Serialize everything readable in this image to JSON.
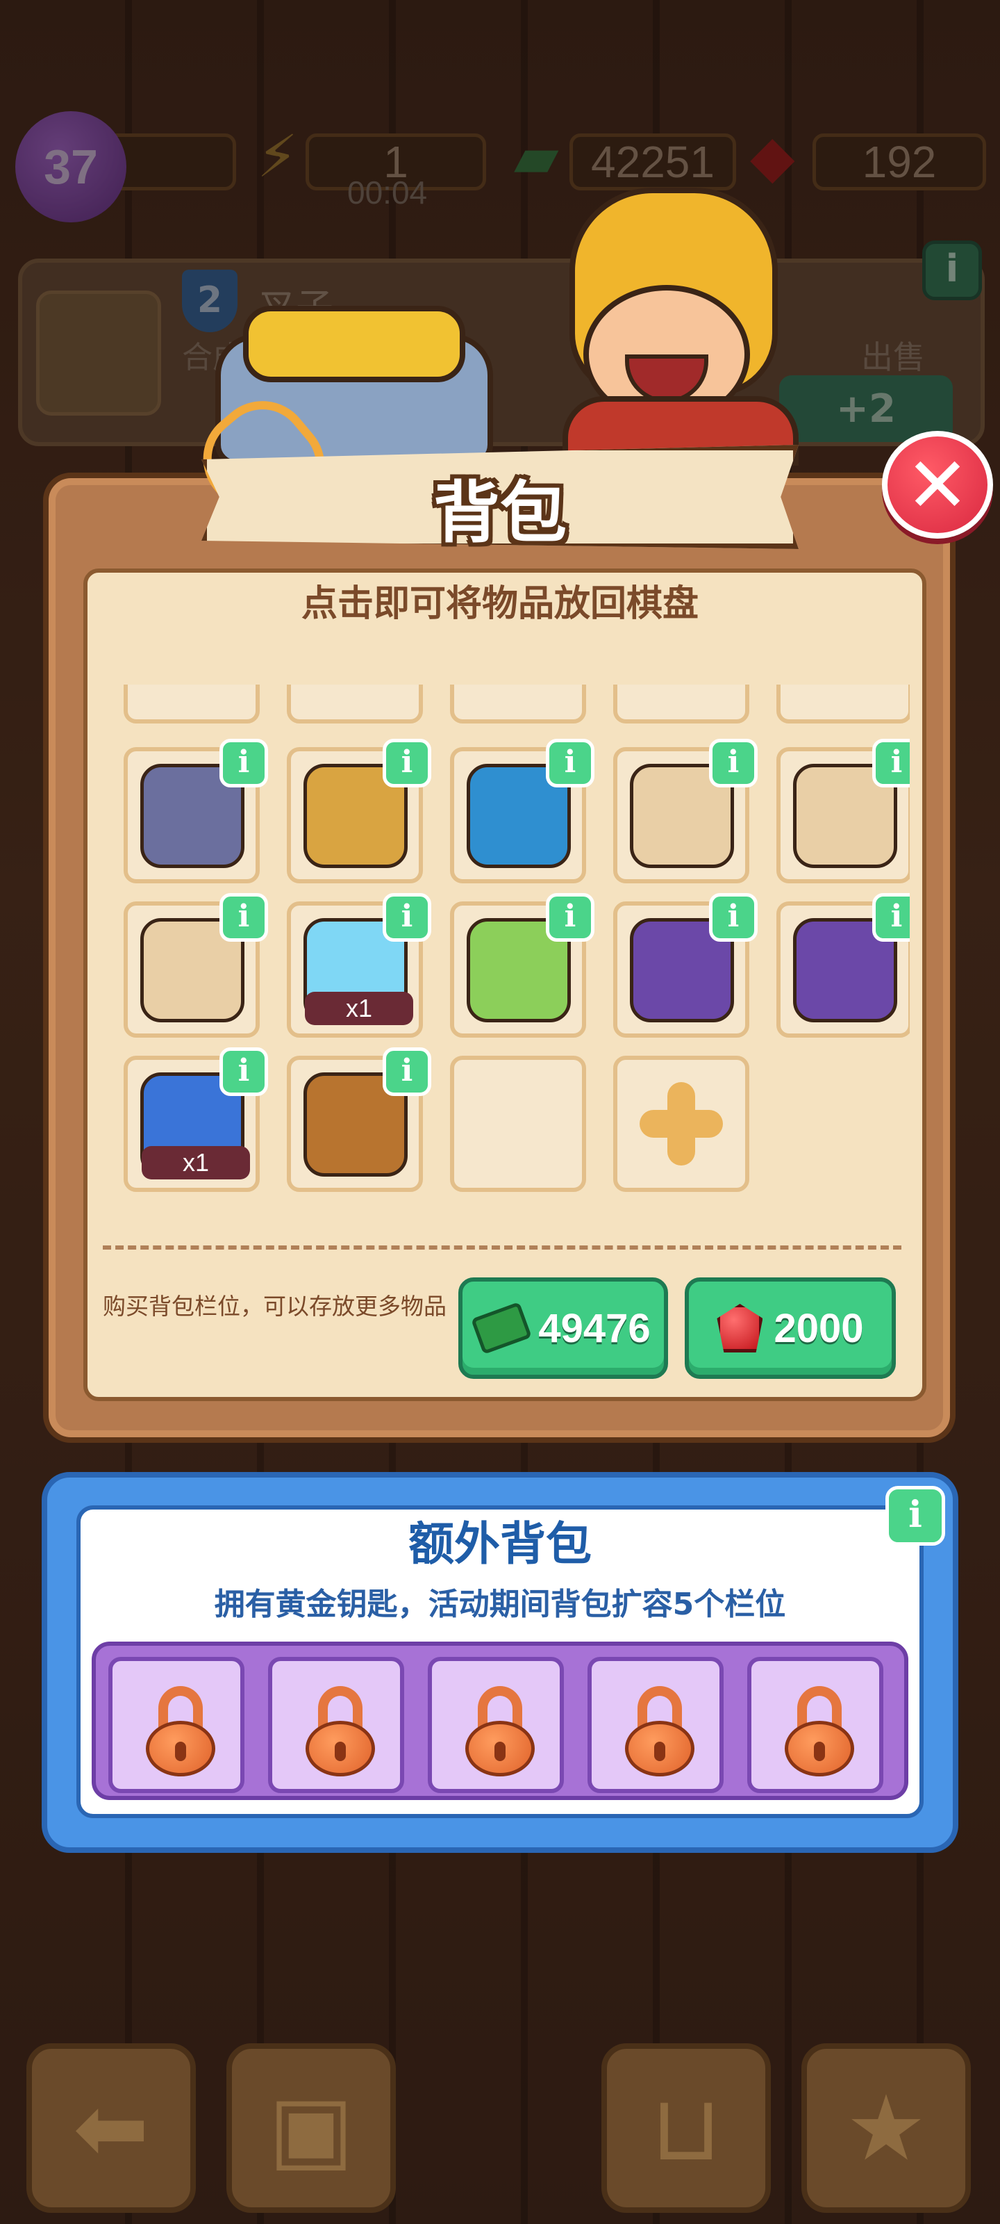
{
  "hud": {
    "level": "37",
    "energy": "1",
    "energy_timer": "00:04",
    "cash": "42251",
    "gems": "192"
  },
  "tool_card": {
    "tool_level": "2",
    "tool_name": "叉子",
    "tool_desc": "合成",
    "sell_label": "出售",
    "sell_value": "+2"
  },
  "backpack": {
    "title": "背包",
    "hint": "点击即可将物品放回棋盘",
    "info_glyph": "i",
    "close_glyph": "✕",
    "items": [
      {
        "name": "wheels-item",
        "qty": ""
      },
      {
        "name": "treasure-chest-item",
        "qty": ""
      },
      {
        "name": "jewel-chest-item",
        "qty": ""
      },
      {
        "name": "construction-box-item",
        "qty": ""
      },
      {
        "name": "construction-box-item",
        "qty": ""
      },
      {
        "name": "lightbulb-box-item",
        "qty": ""
      },
      {
        "name": "scissors-bubble-item",
        "qty": "x1"
      },
      {
        "name": "frog-slippers-item",
        "qty": ""
      },
      {
        "name": "purple-tent-item",
        "qty": ""
      },
      {
        "name": "purple-tent-item",
        "qty": ""
      },
      {
        "name": "upgrade-card-item",
        "qty": "x1"
      },
      {
        "name": "dog-item",
        "qty": ""
      }
    ],
    "buy_text": "购买背包栏位，可以存放更多物品",
    "buy_cash_price": "49476",
    "buy_gem_price": "2000"
  },
  "extra_backpack": {
    "title": "额外背包",
    "subtitle": "拥有黄金钥匙，活动期间背包扩容5个栏位",
    "locked_slots": 5
  },
  "colors": {
    "accent_green": "#3fcc84",
    "extra_blue": "#4a94e6",
    "lock_purple": "#a772d6",
    "close_red": "#d92840"
  }
}
